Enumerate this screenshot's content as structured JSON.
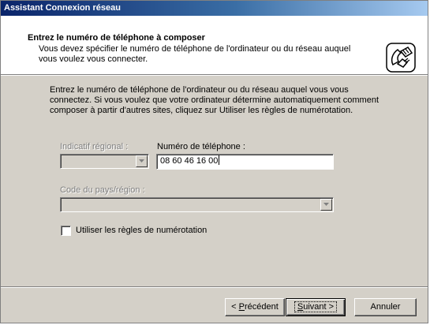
{
  "window": {
    "title": "Assistant Connexion réseau"
  },
  "header": {
    "title": "Entrez le numéro de téléphone à composer",
    "subtitle": "Vous devez spécifier le numéro de téléphone de l'ordinateur ou du réseau auquel vous voulez vous connecter.",
    "icon": "phone-icon"
  },
  "body": {
    "instructions": "Entrez le numéro de téléphone de l'ordinateur ou du réseau auquel vous vous connectez. Si vous voulez que votre ordinateur détermine automatiquement comment composer à partir d'autres sites, cliquez sur Utiliser les règles de numérotation."
  },
  "form": {
    "area_code_label": "Indicatif régional :",
    "phone_label": "Numéro de téléphone :",
    "phone_value": "08 60 46 16 00",
    "country_label": "Code du pays/région :",
    "dialing_rules_label": "Utiliser les règles de numérotation",
    "dialing_rules_checked": false
  },
  "buttons": {
    "back_prefix": "< ",
    "back_mnemonic": "P",
    "back_rest": "récédent",
    "next_mnemonic": "S",
    "next_rest": "uivant >",
    "cancel": "Annuler"
  },
  "colors": {
    "titlebar": "#0a246a",
    "face": "#d4d0c8"
  }
}
